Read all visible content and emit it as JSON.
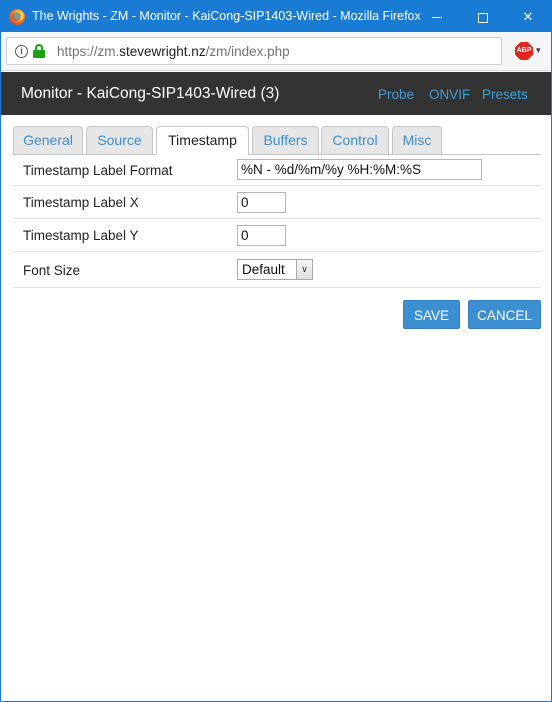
{
  "window": {
    "title": "The Wrights - ZM - Monitor - KaiCong-SIP1403-Wired - Mozilla Firefox",
    "app_icon": "firefox-icon",
    "controls": {
      "minimize": "minimize-icon",
      "maximize": "maximize-icon",
      "close": "✕"
    }
  },
  "urlbar": {
    "url_prefix": "https://zm.",
    "url_domain": "stevewright.nz",
    "url_path": "/zm/index.php",
    "info_glyph": "i",
    "extension_label": "ABP",
    "extension_dropdown": "▾"
  },
  "header": {
    "title": "Monitor - KaiCong-SIP1403-Wired (3)",
    "links": [
      "Probe",
      "ONVIF",
      "Presets"
    ]
  },
  "tabs": [
    {
      "label": "General",
      "active": false
    },
    {
      "label": "Source",
      "active": false
    },
    {
      "label": "Timestamp",
      "active": true
    },
    {
      "label": "Buffers",
      "active": false
    },
    {
      "label": "Control",
      "active": false
    },
    {
      "label": "Misc",
      "active": false
    }
  ],
  "form": {
    "fields": [
      {
        "label": "Timestamp Label Format",
        "value": "%N - %d/%m/%y %H:%M:%S"
      },
      {
        "label": "Timestamp Label X",
        "value": "0"
      },
      {
        "label": "Timestamp Label Y",
        "value": "0"
      },
      {
        "label": "Font Size",
        "value": "Default",
        "dropdown_arrow": "∨"
      }
    ]
  },
  "buttons": {
    "save": "SAVE",
    "cancel": "CANCEL"
  },
  "colors": {
    "titlebar": "#1a7bd4",
    "header": "#333333",
    "accent": "#3c8fd0",
    "link": "#3c9ddd"
  }
}
